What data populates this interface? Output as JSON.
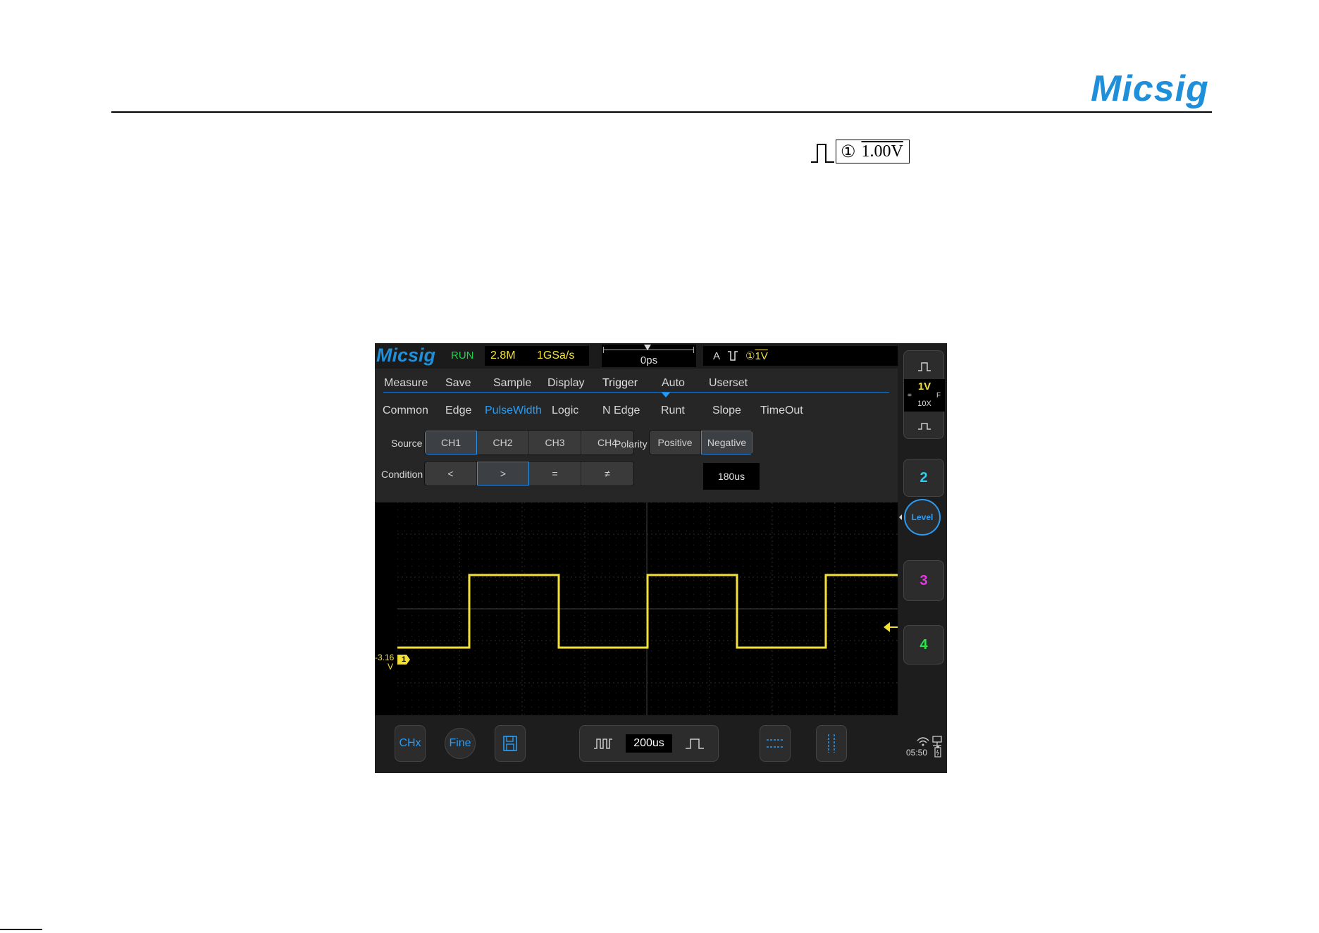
{
  "page": {
    "brand": "Micsig",
    "trigger_legend": {
      "channel": "①",
      "level": "1.00V"
    }
  },
  "scope": {
    "logo": "Micsig",
    "status": "RUN",
    "memory_depth": "2.8M",
    "sample_rate": "1GSa/s",
    "trigger_delay": "0ps",
    "trigger_info": {
      "mode": "A",
      "channel": "①",
      "level": "1V"
    },
    "menu_tabs": [
      {
        "label": "Measure"
      },
      {
        "label": "Save"
      },
      {
        "label": "Sample"
      },
      {
        "label": "Display"
      },
      {
        "label": "Trigger",
        "active": true
      },
      {
        "label": "Auto"
      },
      {
        "label": "Userset"
      }
    ],
    "trigger_types": [
      {
        "label": "Common"
      },
      {
        "label": "Edge"
      },
      {
        "label": "PulseWidth",
        "active": true
      },
      {
        "label": "Logic"
      },
      {
        "label": "N Edge"
      },
      {
        "label": "Runt"
      },
      {
        "label": "Slope"
      },
      {
        "label": "TimeOut"
      }
    ],
    "source": {
      "label": "Source",
      "options": [
        "CH1",
        "CH2",
        "CH3",
        "CH4"
      ],
      "selected": "CH1"
    },
    "polarity": {
      "label": "Polarity",
      "options": [
        "Positive",
        "Negative"
      ],
      "selected": "Negative"
    },
    "condition": {
      "label": "Condition",
      "options": [
        "<",
        ">",
        "=",
        "≠"
      ],
      "selected": ">"
    },
    "pulse_width": "180us",
    "ch1_offset": {
      "value": "-3.16",
      "unit": "V"
    },
    "ch1_marker": "1",
    "bottom": {
      "chx_label": "CHx",
      "fine_label": "Fine",
      "timebase": "200us"
    },
    "side": {
      "ch1_scale": "1V",
      "ch1_probe": "10X",
      "ch1_coupling": "=",
      "ch1_bw": "F",
      "ch2": "2",
      "level": "Level",
      "ch3": "3",
      "ch4": "4",
      "clock": "05:50"
    },
    "colors": {
      "accent": "#2a9cf3",
      "ch1": "#f3e13a",
      "ch2": "#2ad0f0",
      "ch3": "#e43adf",
      "ch4": "#2ee04a",
      "run": "#22d04a"
    }
  }
}
